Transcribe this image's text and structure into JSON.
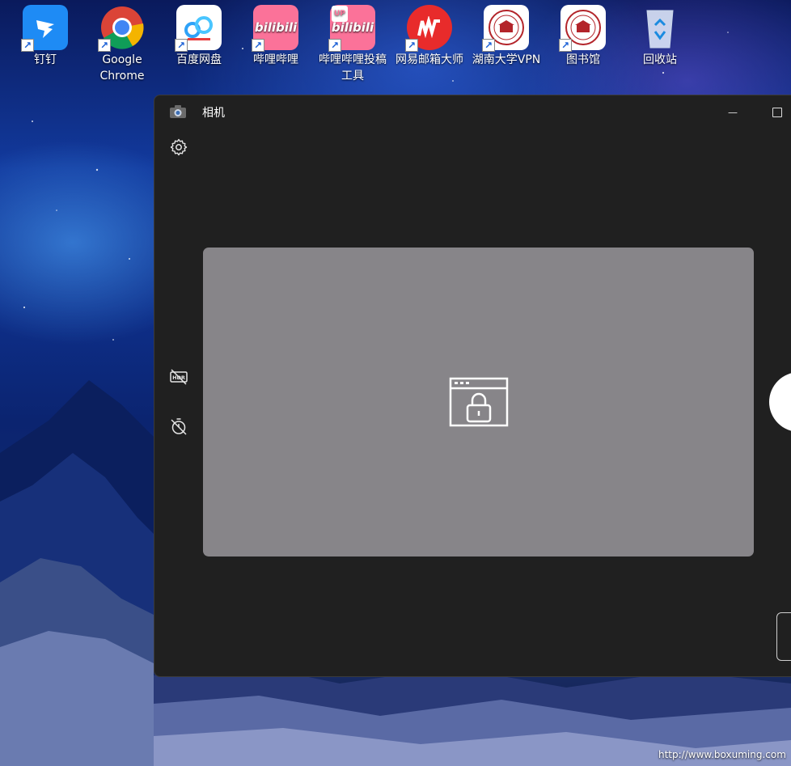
{
  "desktop": {
    "icons": [
      {
        "label": "钉钉"
      },
      {
        "label": "Google\nChrome"
      },
      {
        "label": "百度网盘"
      },
      {
        "label": "哔哩哔哩"
      },
      {
        "label": "哔哩哔哩投稿\n工具"
      },
      {
        "label": "网易邮箱大师"
      },
      {
        "label": "湖南大学VPN"
      },
      {
        "label": "图书馆"
      },
      {
        "label": "回收站"
      }
    ],
    "tile_texts": {
      "bilibili": "bilibili",
      "bilibili_up": "UP"
    }
  },
  "window": {
    "title": "相机",
    "minimize_glyph": "—"
  },
  "watermark": "http://www.boxuming.com",
  "colors": {
    "window_bg": "#202020",
    "preview_bg": "#878589",
    "accent": "#ffffff"
  },
  "icons": {
    "settings": "gear-icon",
    "hdr": "hdr-off-icon",
    "timer": "timer-off-icon",
    "privacy": "browser-lock-icon",
    "app": "camera-icon"
  }
}
